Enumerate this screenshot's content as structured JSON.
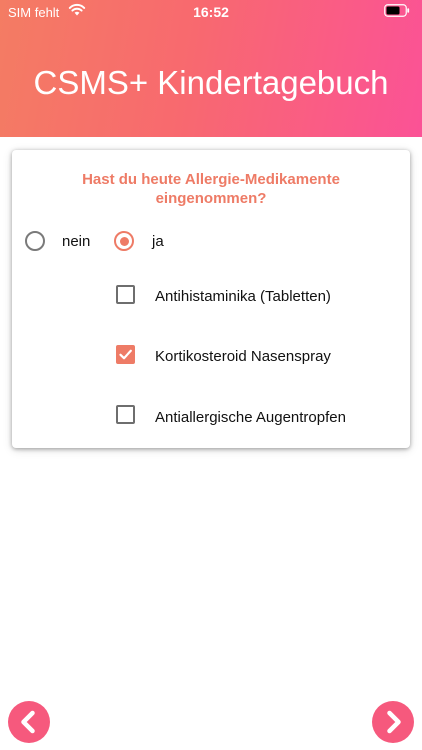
{
  "status_bar": {
    "carrier": "SIM fehlt",
    "time": "16:52",
    "wifi_icon": "wifi-icon",
    "battery_icon": "battery-icon"
  },
  "header": {
    "title": "CSMS+ Kindertagebuch"
  },
  "question": {
    "text": "Hast du heute Allergie-Medikamente eingenommen?",
    "options": [
      {
        "label": "nein",
        "selected": false
      },
      {
        "label": "ja",
        "selected": true
      }
    ],
    "medications": [
      {
        "label": "Antihistaminika (Tabletten)",
        "checked": false
      },
      {
        "label": "Kortikosteroid Nasenspray",
        "checked": true
      },
      {
        "label": "Antiallergische Augentropfen",
        "checked": false
      }
    ]
  },
  "navigation": {
    "back_icon": "chevron-left-icon",
    "next_icon": "chevron-right-icon"
  },
  "colors": {
    "gradient_start": "#f47c63",
    "gradient_end": "#fb5296",
    "accent": "#ee7b66",
    "nav_button": "#f6597d"
  }
}
